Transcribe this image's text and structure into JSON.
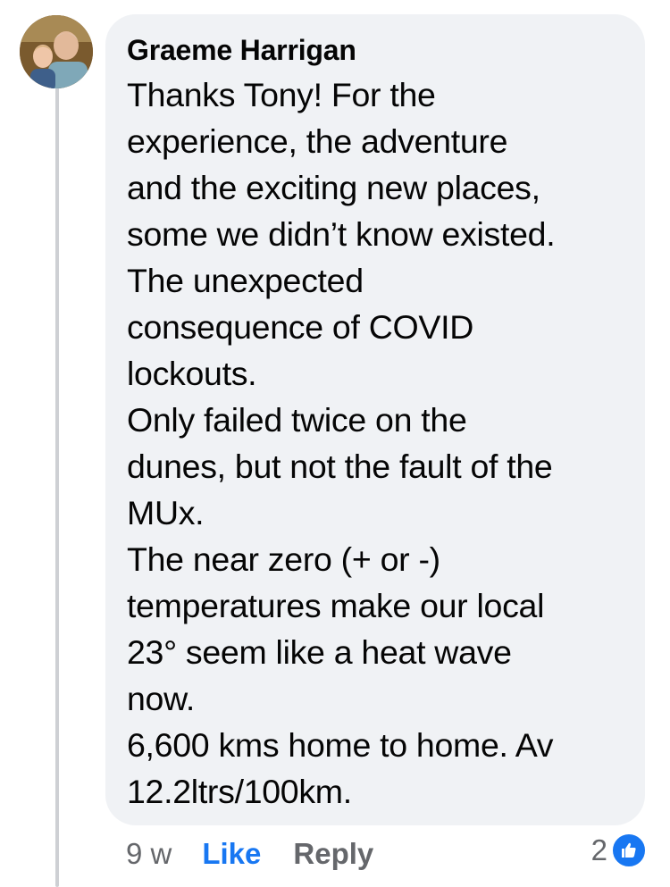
{
  "comment": {
    "author": "Graeme Harrigan",
    "text_lines": [
      "Thanks Tony! For the",
      "experience, the adventure",
      "and the exciting new places,",
      "some we didn’t know existed.",
      "The unexpected",
      "consequence of COVID",
      "lockouts.",
      "Only failed twice on the",
      "dunes, but not the fault of the",
      "MUx.",
      "The near zero (+ or -)",
      "temperatures make our local",
      "23° seem like a heat wave",
      "now.",
      "6,600 kms home to home. Av",
      "12.2ltrs/100km."
    ]
  },
  "actions": {
    "time": "9 w",
    "like_label": "Like",
    "reply_label": "Reply"
  },
  "reactions": {
    "count": "2",
    "icon": "thumbs-up-icon"
  },
  "colors": {
    "bubble": "#f0f2f5",
    "like_blue": "#1877f2",
    "muted": "#65676b"
  }
}
